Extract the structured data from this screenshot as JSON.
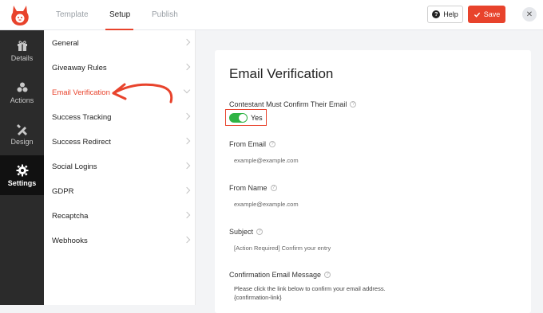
{
  "header": {
    "tabs": [
      {
        "label": "Template"
      },
      {
        "label": "Setup"
      },
      {
        "label": "Publish"
      }
    ],
    "help_label": "Help",
    "save_label": "Save",
    "accent_color": "#e8432c"
  },
  "sidebar": {
    "items": [
      {
        "label": "Details",
        "icon": "gift-icon"
      },
      {
        "label": "Actions",
        "icon": "actions-icon"
      },
      {
        "label": "Design",
        "icon": "design-icon"
      },
      {
        "label": "Settings",
        "icon": "gear-icon"
      }
    ],
    "active": "Settings"
  },
  "settings_nav": {
    "items": [
      {
        "label": "General"
      },
      {
        "label": "Giveaway Rules"
      },
      {
        "label": "Email Verification"
      },
      {
        "label": "Success Tracking"
      },
      {
        "label": "Success Redirect"
      },
      {
        "label": "Social Logins"
      },
      {
        "label": "GDPR"
      },
      {
        "label": "Recaptcha"
      },
      {
        "label": "Webhooks"
      }
    ],
    "active": "Email Verification"
  },
  "panel": {
    "title": "Email Verification",
    "confirm_label": "Contestant Must Confirm Their Email",
    "confirm_toggle_text": "Yes",
    "confirm_enabled": true,
    "from_email_label": "From Email",
    "from_email_value": "example@example.com",
    "from_name_label": "From Name",
    "from_name_value": "example@example.com",
    "subject_label": "Subject",
    "subject_value": "[Action Required] Confirm your entry",
    "message_label": "Confirmation Email Message",
    "message_line1": "Please click the link below to confirm your email address.",
    "message_line2": "{confirmation-link}"
  }
}
